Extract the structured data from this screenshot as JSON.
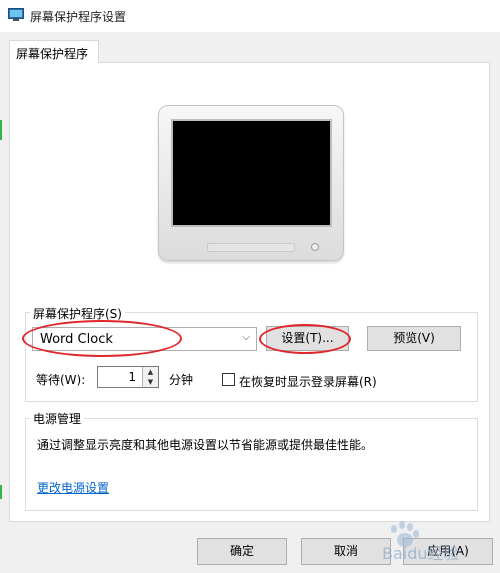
{
  "window": {
    "title": "屏幕保护程序设置"
  },
  "tab": {
    "label": "屏幕保护程序"
  },
  "screensaver": {
    "group_label": "屏幕保护程序(S)",
    "selected": "Word Clock",
    "settings_button": "设置(T)...",
    "preview_button": "预览(V)",
    "wait_label": "等待(W):",
    "wait_value": "1",
    "minutes_label": "分钟",
    "resume_label": "在恢复时显示登录屏幕(R)"
  },
  "power": {
    "group_label": "电源管理",
    "description": "通过调整显示亮度和其他电源设置以节省能源或提供最佳性能。",
    "link": "更改电源设置"
  },
  "buttons": {
    "ok": "确定",
    "cancel": "取消",
    "apply": "应用(A)"
  },
  "watermark": {
    "text": "Baidu经验"
  },
  "colors": {
    "annotation": "#e0262a",
    "link": "#0066cc"
  }
}
